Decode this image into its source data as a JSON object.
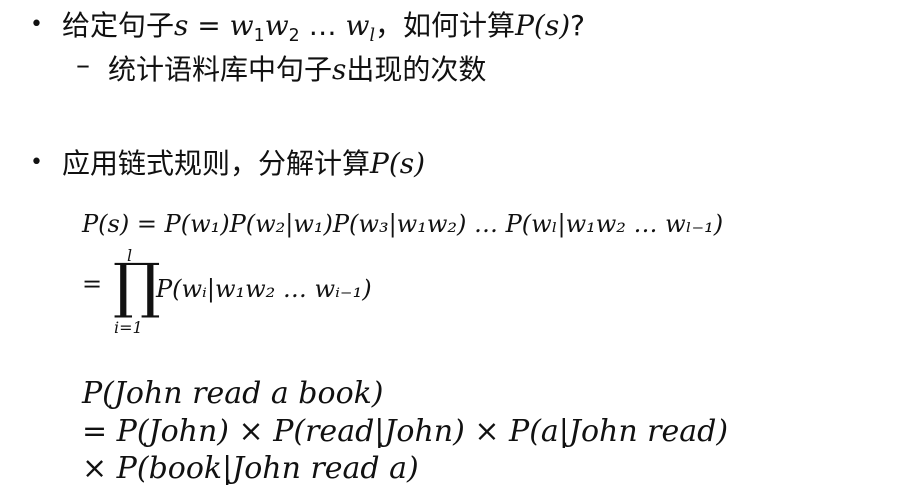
{
  "bullets": [
    {
      "marker": "•",
      "text_pre": "给定句子",
      "text_mid": "，如何计算",
      "text_post": "?",
      "formula_s": "s",
      "formula_eq": "= ",
      "formula_w1": "w",
      "formula_w1_sub": "1",
      "formula_w2": "w",
      "formula_w2_sub": "2",
      "formula_dots": " … ",
      "formula_wl": "w",
      "formula_wl_sub": "l",
      "formula_ps": "P(s)",
      "sub_marker": "–",
      "sub_text_pre": "统计语料库中句子",
      "sub_text_s": "s",
      "sub_text_post": "出现的次数"
    },
    {
      "marker": "•",
      "text_pre": "应用链式规则，分解计算",
      "formula_ps": "P(s)"
    }
  ],
  "equations": {
    "chain_rule_line1": "P(s) = P(w₁)P(w₂|w₁)P(w₃|w₁w₂) … P(wₗ|w₁w₂ … wₗ₋₁)",
    "chain_rule_eq": "=",
    "product_symbol": "∏",
    "product_upper": "l",
    "product_lower": "i=1",
    "chain_rule_line2": "P(wᵢ|w₁w₂ … wᵢ₋₁)",
    "example_line1": "P(John read a book)",
    "example_line2": "= P(John) × P(read|John) × P(a|John read)",
    "example_line3": "× P(book|John read a)"
  }
}
